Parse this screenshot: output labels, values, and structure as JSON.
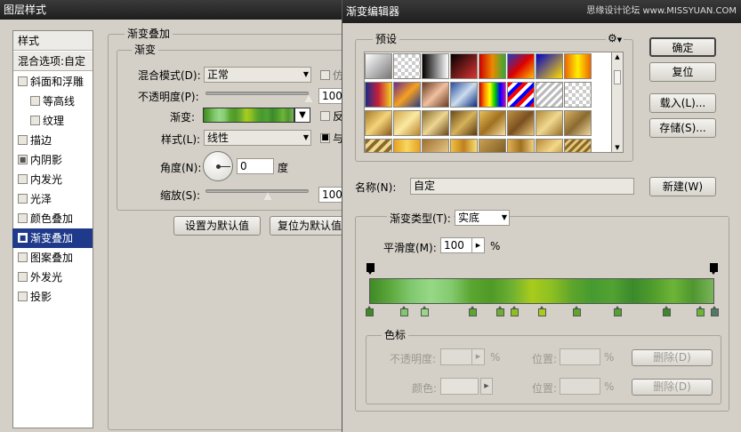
{
  "layer_style": {
    "title": "图层样式",
    "sidebar": {
      "header": "样式",
      "blend_options": "混合选项:自定",
      "items": [
        {
          "label": "斜面和浮雕",
          "sub": false,
          "checked": false
        },
        {
          "label": "等高线",
          "sub": true,
          "checked": false
        },
        {
          "label": "纹理",
          "sub": true,
          "checked": false
        },
        {
          "label": "描边",
          "sub": false,
          "checked": false
        },
        {
          "label": "内阴影",
          "sub": false,
          "checked": true
        },
        {
          "label": "内发光",
          "sub": false,
          "checked": false
        },
        {
          "label": "光泽",
          "sub": false,
          "checked": false
        },
        {
          "label": "颜色叠加",
          "sub": false,
          "checked": false
        },
        {
          "label": "渐变叠加",
          "sub": false,
          "checked": true,
          "selected": true
        },
        {
          "label": "图案叠加",
          "sub": false,
          "checked": false
        },
        {
          "label": "外发光",
          "sub": false,
          "checked": false
        },
        {
          "label": "投影",
          "sub": false,
          "checked": false
        }
      ]
    },
    "panel": {
      "group_title": "渐变叠加",
      "sub_title": "渐变",
      "blend_mode_label": "混合模式(D):",
      "blend_mode_value": "正常",
      "dither_label": "仿",
      "opacity_label": "不透明度(P):",
      "opacity_value": "100",
      "opacity_level": 1.0,
      "gradient_label": "渐变:",
      "reverse_label": "反",
      "style_label": "样式(L):",
      "style_value": "线性",
      "align_label": "与",
      "angle_label": "角度(N):",
      "angle_value": "0",
      "angle_unit": "度",
      "scale_label": "缩放(S):",
      "scale_value": "100",
      "scale_level": 0.6,
      "set_default": "设置为默认值",
      "reset_default": "复位为默认值"
    }
  },
  "gradient_editor": {
    "title": "渐变编辑器",
    "watermark": "思缘设计论坛 www.MISSYUAN.COM",
    "presets_label": "预设",
    "buttons": {
      "ok": "确定",
      "reset": "复位",
      "load": "载入(L)...",
      "save": "存储(S)...",
      "new": "新建(W)"
    },
    "name_label": "名称(N):",
    "name_value": "自定",
    "type_label": "渐变类型(T):",
    "type_value": "实底",
    "smooth_label": "平滑度(M):",
    "smooth_value": "100",
    "smooth_unit": "%",
    "stops_group": "色标",
    "opacity_label": "不透明度:",
    "percent": "%",
    "location_label": "位置:",
    "delete_label": "删除(D)",
    "color_label": "颜色:",
    "gradient_colors": [
      "#3e8a25",
      "#5da83c",
      "#7fc86e",
      "#97d886",
      "#84cb70",
      "#5aa630",
      "#4f9a26",
      "#6caf32",
      "#a8cc1c",
      "#8dbf22",
      "#5ea52a",
      "#469a30",
      "#52a231",
      "#3a8a2c",
      "#4f9c2b",
      "#6db537",
      "#4f9630",
      "#7ab45a"
    ],
    "color_stop_positions": [
      0.0,
      0.1,
      0.16,
      0.3,
      0.38,
      0.42,
      0.5,
      0.6,
      0.72,
      0.86,
      0.96,
      1.0
    ],
    "color_stop_colors": [
      "#3e8a25",
      "#7fc86e",
      "#97d886",
      "#5aa630",
      "#6caf32",
      "#8dbf22",
      "#a8cc1c",
      "#5ea52a",
      "#52a231",
      "#3a8a2c",
      "#6db537",
      "#4f7a64"
    ]
  }
}
